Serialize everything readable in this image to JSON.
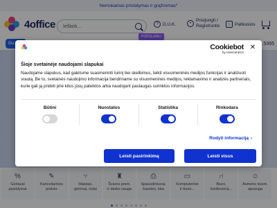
{
  "promo": {
    "text": "Nemokamas pristatymas ir grąžinimas*"
  },
  "header": {
    "logo_text": "4office",
    "search_placeholder": "Ieškoti...",
    "faq_label": "D.U.K.",
    "login_label_1": "Prisijungti /",
    "login_label_2": "Registruotis",
    "favorites_label": "Patikusios"
  },
  "page": {
    "nav_button": "Bia",
    "popular_badge": "POPULIARU",
    "phone": "6 5365"
  },
  "cookie_dialog": {
    "brand": "Cookiebot",
    "brand_sub": "by Usercentrics",
    "title": "Šioje svetainėje naudojami slapukai",
    "body": "Naudojame slapukus, kad galėtume suasmeninti turinį bei skelbimus, teikti visuomeninės medijos funkcijas ir analizuoti srautą. Be to, svetainės naudojimo informacija bendriname su visuomeninės medijos, reklamavimo ir analizės partneriais, kurie gali ją pridėti prie kitos jūsų pateiktos arba naudojant paslaugas surinktos informacijos.",
    "toggles": [
      {
        "label": "Būtini",
        "state": "off"
      },
      {
        "label": "Nuostatos",
        "state": "on"
      },
      {
        "label": "Statistika",
        "state": "on"
      },
      {
        "label": "Rinkodara",
        "state": "on"
      }
    ],
    "details_link": "Rodyti informaciją",
    "allow_selection": "Leisti pasirinkimą",
    "allow_all": "Leisti visus",
    "accent_color": "#1032cf"
  },
  "categories": [
    {
      "icon": "percent-icon",
      "line1": "Geriausi",
      "line2": "pasiūlymai"
    },
    {
      "icon": "office-supplies-icon",
      "line1": "Kanceliarinės",
      "line2": "prekės"
    },
    {
      "icon": "cutlery-icon",
      "line1": "Maistas,",
      "line2": "gėrimai, indai"
    },
    {
      "icon": "spray-icon",
      "line1": "Švaros prem.",
      "line2": "ir darbo sauga"
    },
    {
      "icon": "printer-icon",
      "line1": "Spausdintuvai,",
      "line2": "kasetės, kita"
    },
    {
      "icon": "computer-icon",
      "line1": "Kompiuterinė",
      "line2": "ir biuro..."
    },
    {
      "icon": "chair-icon",
      "line1": "Biuro,",
      "line2": "konferencij..."
    },
    {
      "icon": "person-icon",
      "line1": "Asmens duom.",
      "line2": "apsauga"
    }
  ]
}
